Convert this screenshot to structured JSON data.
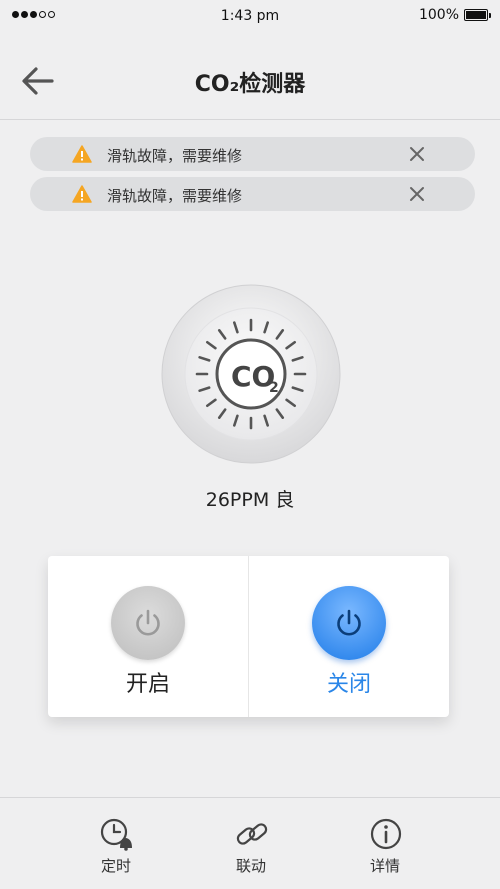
{
  "status_bar": {
    "signal_bars": 3,
    "signal_total": 5,
    "time": "1:43 pm",
    "battery_percent": "100%",
    "battery_level": 1.0
  },
  "header": {
    "title": "CO₂检测器",
    "back_icon": "arrow-left-icon"
  },
  "alerts": [
    {
      "icon": "warning-triangle-icon",
      "text": "滑轨故障，需要维修",
      "close_icon": "close-icon"
    },
    {
      "icon": "warning-triangle-icon",
      "text": "滑轨故障，需要维修",
      "close_icon": "close-icon"
    }
  ],
  "sensor": {
    "icon_text": "CO",
    "icon_subscript": "2",
    "reading": "26PPM 良"
  },
  "controls": {
    "on": {
      "label": "开启",
      "state": "inactive",
      "icon": "power-icon"
    },
    "off": {
      "label": "关闭",
      "state": "active",
      "icon": "power-icon"
    }
  },
  "tabs": [
    {
      "label": "定时",
      "icon": "timer-bell-icon"
    },
    {
      "label": "联动",
      "icon": "link-icon"
    },
    {
      "label": "详情",
      "icon": "info-icon"
    }
  ],
  "colors": {
    "background": "#efeff0",
    "accent_blue": "#2a86e8",
    "warning": "#f5a623",
    "alert_bg": "#dddee0"
  }
}
